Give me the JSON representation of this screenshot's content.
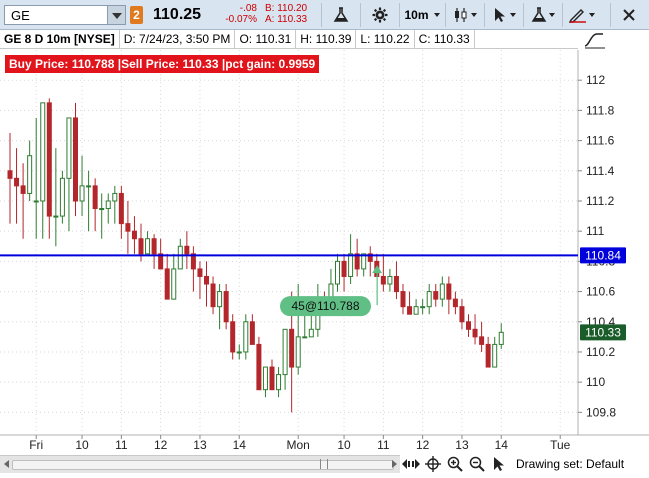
{
  "toolbar": {
    "symbol": "GE",
    "badge": "2",
    "last_price": "110.25",
    "change": "-.08",
    "change_pct": "-0.07%",
    "bid": "B: 110.20",
    "ask": "A: 110.33",
    "timeframe": "10m",
    "icons": [
      "flask-icon",
      "gear-icon",
      "timeframe-dropdown",
      "candle-style-icon",
      "cursor-icon",
      "studies-flask-icon",
      "drawing-pencil-icon",
      "close-icon"
    ]
  },
  "infobar": {
    "title": "GE 8 D 10m [NYSE]",
    "date": "D: 7/24/23, 3:50 PM",
    "open": "O: 110.31",
    "high": "H: 110.39",
    "low": "L: 110.22",
    "close": "C: 110.33"
  },
  "study_label": "Buy Price: 110.788  |Sell Price: 110.33  |pct gain: 0.9959",
  "bottom": {
    "drawing_set": "Drawing set: Default"
  },
  "colors": {
    "up": "#2e7d32",
    "down": "#b3262b",
    "level_line": "#0000dd",
    "level_bubble": "#0000dd",
    "last_bubble": "#1a5d2a",
    "order_bubble": "#5fbf84",
    "study_label": "#e0141a"
  },
  "chart_data": {
    "type": "candlestick",
    "ylim": [
      109.65,
      112.2
    ],
    "y_ticks": [
      "112",
      "111.8",
      "111.6",
      "111.4",
      "111.2",
      "111",
      "110.8",
      "110.6",
      "110.4",
      "110.2",
      "110",
      "109.8"
    ],
    "x_ticks": [
      {
        "label": "Fri",
        "index": 4
      },
      {
        "label": "10",
        "index": 11
      },
      {
        "label": "11",
        "index": 17
      },
      {
        "label": "12",
        "index": 23
      },
      {
        "label": "13",
        "index": 29
      },
      {
        "label": "14",
        "index": 35
      },
      {
        "label": "Mon",
        "index": 44
      },
      {
        "label": "10",
        "index": 51
      },
      {
        "label": "11",
        "index": 57
      },
      {
        "label": "12",
        "index": 63
      },
      {
        "label": "13",
        "index": 69
      },
      {
        "label": "14",
        "index": 75
      },
      {
        "label": "Tue",
        "index": 84
      }
    ],
    "horizontal_line": 110.84,
    "level_label": "110.84",
    "last_label": "110.33",
    "order_label": "45@110.788",
    "order_price": 110.788,
    "order_index": 53,
    "candles": [
      {
        "o": 111.4,
        "h": 111.65,
        "l": 111.05,
        "c": 111.35
      },
      {
        "o": 111.35,
        "h": 111.55,
        "l": 111.05,
        "c": 111.3
      },
      {
        "o": 111.3,
        "h": 111.45,
        "l": 110.95,
        "c": 111.25
      },
      {
        "o": 111.25,
        "h": 111.6,
        "l": 111.2,
        "c": 111.5
      },
      {
        "o": 111.2,
        "h": 111.75,
        "l": 110.95,
        "c": 111.2
      },
      {
        "o": 111.2,
        "h": 111.85,
        "l": 110.95,
        "c": 111.85
      },
      {
        "o": 111.85,
        "h": 111.88,
        "l": 110.95,
        "c": 111.1
      },
      {
        "o": 111.1,
        "h": 111.55,
        "l": 110.9,
        "c": 111.1
      },
      {
        "o": 111.1,
        "h": 111.4,
        "l": 111.05,
        "c": 111.35
      },
      {
        "o": 111.35,
        "h": 111.45,
        "l": 111.0,
        "c": 111.75
      },
      {
        "o": 111.75,
        "h": 111.85,
        "l": 111.1,
        "c": 111.2
      },
      {
        "o": 111.2,
        "h": 111.5,
        "l": 111.1,
        "c": 111.3
      },
      {
        "o": 111.3,
        "h": 111.4,
        "l": 111.0,
        "c": 111.3
      },
      {
        "o": 111.3,
        "h": 111.35,
        "l": 111.0,
        "c": 111.15
      },
      {
        "o": 111.15,
        "h": 111.25,
        "l": 110.95,
        "c": 111.15
      },
      {
        "o": 111.15,
        "h": 111.25,
        "l": 111.05,
        "c": 111.2
      },
      {
        "o": 111.2,
        "h": 111.3,
        "l": 111.05,
        "c": 111.25
      },
      {
        "o": 111.25,
        "h": 111.3,
        "l": 110.95,
        "c": 111.05
      },
      {
        "o": 111.05,
        "h": 111.2,
        "l": 110.85,
        "c": 111.0
      },
      {
        "o": 111.0,
        "h": 111.1,
        "l": 110.85,
        "c": 110.95
      },
      {
        "o": 110.95,
        "h": 111.05,
        "l": 110.8,
        "c": 110.85
      },
      {
        "o": 110.85,
        "h": 111.0,
        "l": 110.85,
        "c": 110.95
      },
      {
        "o": 110.95,
        "h": 110.98,
        "l": 110.75,
        "c": 110.85
      },
      {
        "o": 110.85,
        "h": 110.95,
        "l": 110.75,
        "c": 110.75
      },
      {
        "o": 110.75,
        "h": 110.85,
        "l": 110.55,
        "c": 110.55
      },
      {
        "o": 110.55,
        "h": 110.85,
        "l": 110.55,
        "c": 110.75
      },
      {
        "o": 110.75,
        "h": 110.95,
        "l": 110.75,
        "c": 110.9
      },
      {
        "o": 110.9,
        "h": 111.0,
        "l": 110.75,
        "c": 110.85
      },
      {
        "o": 110.85,
        "h": 110.9,
        "l": 110.6,
        "c": 110.75
      },
      {
        "o": 110.75,
        "h": 110.8,
        "l": 110.55,
        "c": 110.7
      },
      {
        "o": 110.7,
        "h": 110.8,
        "l": 110.5,
        "c": 110.65
      },
      {
        "o": 110.65,
        "h": 110.7,
        "l": 110.45,
        "c": 110.5
      },
      {
        "o": 110.5,
        "h": 110.65,
        "l": 110.35,
        "c": 110.6
      },
      {
        "o": 110.6,
        "h": 110.65,
        "l": 110.35,
        "c": 110.4
      },
      {
        "o": 110.4,
        "h": 110.45,
        "l": 110.15,
        "c": 110.2
      },
      {
        "o": 110.2,
        "h": 110.25,
        "l": 110.15,
        "c": 110.2
      },
      {
        "o": 110.2,
        "h": 110.45,
        "l": 110.15,
        "c": 110.4
      },
      {
        "o": 110.4,
        "h": 110.45,
        "l": 110.25,
        "c": 110.25
      },
      {
        "o": 110.25,
        "h": 110.3,
        "l": 109.95,
        "c": 109.95
      },
      {
        "o": 109.95,
        "h": 110.1,
        "l": 109.9,
        "c": 110.1
      },
      {
        "o": 110.1,
        "h": 110.15,
        "l": 109.95,
        "c": 109.95
      },
      {
        "o": 109.95,
        "h": 110.1,
        "l": 109.9,
        "c": 110.05
      },
      {
        "o": 110.05,
        "h": 110.35,
        "l": 109.95,
        "c": 110.35
      },
      {
        "o": 110.35,
        "h": 110.6,
        "l": 109.8,
        "c": 110.1
      },
      {
        "o": 110.1,
        "h": 110.65,
        "l": 110.05,
        "c": 110.3
      },
      {
        "o": 110.3,
        "h": 110.5,
        "l": 110.3,
        "c": 110.3
      },
      {
        "o": 110.3,
        "h": 110.45,
        "l": 110.3,
        "c": 110.35
      },
      {
        "o": 110.35,
        "h": 110.65,
        "l": 110.3,
        "c": 110.55
      },
      {
        "o": 110.55,
        "h": 110.6,
        "l": 110.5,
        "c": 110.5
      },
      {
        "o": 110.5,
        "h": 110.75,
        "l": 110.45,
        "c": 110.65
      },
      {
        "o": 110.65,
        "h": 110.85,
        "l": 110.6,
        "c": 110.8
      },
      {
        "o": 110.8,
        "h": 110.85,
        "l": 110.6,
        "c": 110.7
      },
      {
        "o": 110.7,
        "h": 110.98,
        "l": 110.65,
        "c": 110.85
      },
      {
        "o": 110.85,
        "h": 110.95,
        "l": 110.7,
        "c": 110.75
      },
      {
        "o": 110.75,
        "h": 110.85,
        "l": 110.7,
        "c": 110.85
      },
      {
        "o": 110.85,
        "h": 110.9,
        "l": 110.7,
        "c": 110.8
      },
      {
        "o": 110.8,
        "h": 110.85,
        "l": 110.7,
        "c": 110.7
      },
      {
        "o": 110.7,
        "h": 110.85,
        "l": 110.6,
        "c": 110.65
      },
      {
        "o": 110.65,
        "h": 110.75,
        "l": 110.6,
        "c": 110.7
      },
      {
        "o": 110.7,
        "h": 110.8,
        "l": 110.55,
        "c": 110.6
      },
      {
        "o": 110.6,
        "h": 110.65,
        "l": 110.45,
        "c": 110.5
      },
      {
        "o": 110.5,
        "h": 110.6,
        "l": 110.45,
        "c": 110.45
      },
      {
        "o": 110.45,
        "h": 110.55,
        "l": 110.45,
        "c": 110.5
      },
      {
        "o": 110.5,
        "h": 110.55,
        "l": 110.45,
        "c": 110.5
      },
      {
        "o": 110.5,
        "h": 110.65,
        "l": 110.45,
        "c": 110.6
      },
      {
        "o": 110.6,
        "h": 110.65,
        "l": 110.5,
        "c": 110.55
      },
      {
        "o": 110.55,
        "h": 110.7,
        "l": 110.5,
        "c": 110.65
      },
      {
        "o": 110.65,
        "h": 110.7,
        "l": 110.45,
        "c": 110.55
      },
      {
        "o": 110.55,
        "h": 110.6,
        "l": 110.45,
        "c": 110.5
      },
      {
        "o": 110.5,
        "h": 110.55,
        "l": 110.35,
        "c": 110.4
      },
      {
        "o": 110.4,
        "h": 110.45,
        "l": 110.3,
        "c": 110.35
      },
      {
        "o": 110.35,
        "h": 110.45,
        "l": 110.25,
        "c": 110.3
      },
      {
        "o": 110.3,
        "h": 110.4,
        "l": 110.2,
        "c": 110.25
      },
      {
        "o": 110.25,
        "h": 110.3,
        "l": 110.1,
        "c": 110.1
      },
      {
        "o": 110.1,
        "h": 110.3,
        "l": 110.1,
        "c": 110.25
      },
      {
        "o": 110.25,
        "h": 110.39,
        "l": 110.22,
        "c": 110.33
      }
    ]
  }
}
